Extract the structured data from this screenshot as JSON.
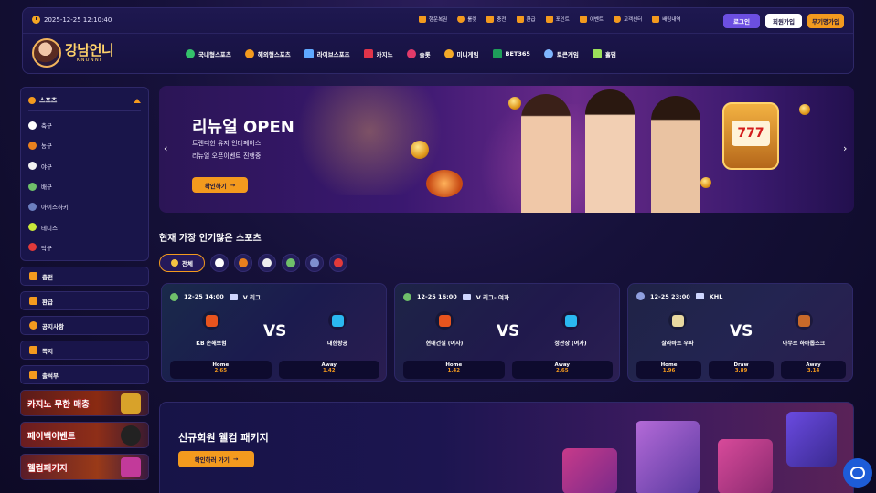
{
  "header": {
    "datetime": "2025-12-25 12:10:40",
    "top_links": [
      "행운복권",
      "룰렛",
      "충전",
      "환급",
      "포인트",
      "이벤트",
      "고객센터",
      "배팅내역"
    ],
    "login_label": "로그인",
    "join_label": "회원가입",
    "free_join_label": "무기명가입",
    "logo_text": "강남언니",
    "logo_sub": "KNUNNI",
    "main_nav": [
      "국내형스포츠",
      "해외형스포츠",
      "라이브스포츠",
      "카지노",
      "슬롯",
      "미니게임",
      "BET365",
      "토큰게임",
      "홀덤"
    ]
  },
  "sidebar": {
    "sports_title": "스포츠",
    "sports": [
      "축구",
      "농구",
      "야구",
      "배구",
      "아이스하키",
      "테니스",
      "탁구"
    ],
    "buttons": [
      "충전",
      "환급",
      "공지사항",
      "쪽지",
      "출석부"
    ],
    "promos": [
      "카지노 무한 매충",
      "페이백이벤트",
      "웰컴패키지"
    ]
  },
  "banner": {
    "title": "리뉴얼 OPEN",
    "line1": "트렌디한 유저 인터페이스!",
    "line2": "리뉴얼 오픈이벤트 진행중",
    "button_label": "확인하기",
    "prev_arrow": "‹",
    "next_arrow": "›",
    "slot_text": "777"
  },
  "popular": {
    "title": "현재 가장 인기많은 스포츠",
    "all_label": "전체"
  },
  "matches": [
    {
      "time": "12-25 14:00",
      "league": "V 리그",
      "home": "KB 손해보험",
      "away": "대한항공",
      "odds": [
        {
          "label": "Home",
          "value": "2.65"
        },
        {
          "label": "Away",
          "value": "1.42"
        }
      ]
    },
    {
      "time": "12-25 16:00",
      "league": "V 리그- 여자",
      "home": "현대건설 (여자)",
      "away": "정관장 (여자)",
      "odds": [
        {
          "label": "Home",
          "value": "1.42"
        },
        {
          "label": "Away",
          "value": "2.65"
        }
      ]
    },
    {
      "time": "12-25 23:00",
      "league": "KHL",
      "home": "살라바트 우파",
      "away": "아무르 하바롭스크",
      "odds": [
        {
          "label": "Home",
          "value": "1.96"
        },
        {
          "label": "Draw",
          "value": "3.89"
        },
        {
          "label": "Away",
          "value": "3.14"
        }
      ]
    }
  ],
  "vs_label": "VS",
  "welcome": {
    "title": "신규회원 웰컴 패키지",
    "button_label": "확인하러 가기"
  },
  "colors": {
    "accent": "#f39a1e",
    "primary": "#6c4fe0",
    "bg": "#16113a"
  }
}
